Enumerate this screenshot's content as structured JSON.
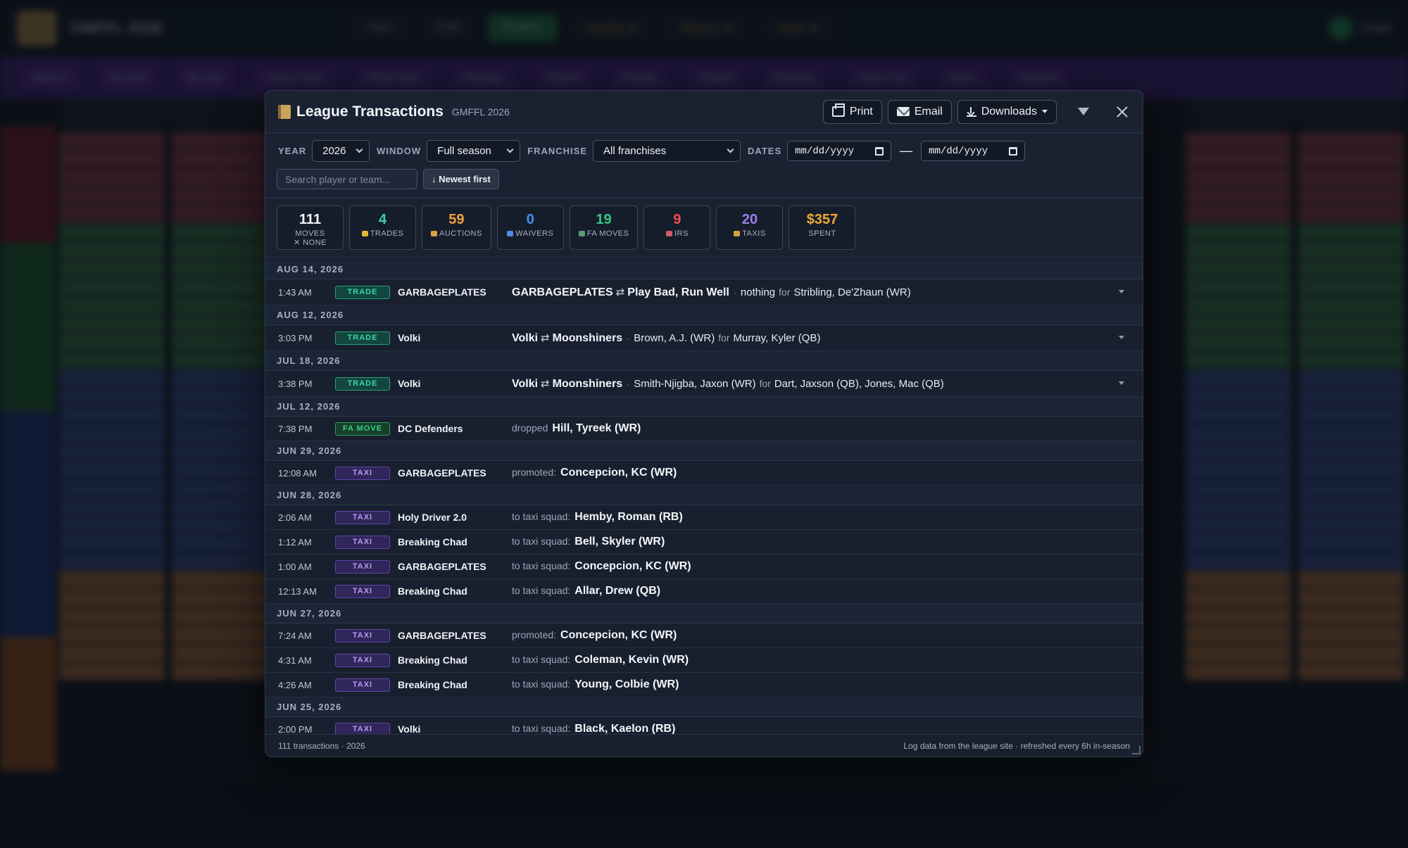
{
  "background_app": {
    "title": "GMFFL 2026",
    "nav": [
      "Start",
      "Draft",
      "Rosters",
      "Trading ★",
      "Waivers ★",
      "News ★"
    ],
    "user": "Chad",
    "subbar": [
      "Week 1",
      "By Slot",
      "By Pos",
      "Jerry's order",
      "What now?",
      "Manage",
      "What-if",
      "Pivotal",
      "Traded",
      "Expiring",
      "Player List",
      "Inbox",
      "Reports"
    ]
  },
  "modal": {
    "title": "League Transactions",
    "subtitle": "GMFFL 2026",
    "print_label": "Print",
    "email_label": "Email",
    "downloads_label": "Downloads"
  },
  "filters": {
    "year_label": "YEAR",
    "year_value": "2026",
    "window_label": "WINDOW",
    "window_value": "Full season",
    "franchise_label": "FRANCHISE",
    "franchise_value": "All franchises",
    "dates_label": "DATES",
    "date_from": "mm/dd/yyyy",
    "date_to": "mm/dd/yyyy",
    "dates_sep": "—",
    "search_placeholder": "Search player or team...",
    "sort_label": "↓ Newest first"
  },
  "stats": [
    {
      "num": "111",
      "label": "MOVES",
      "sub": "✕ NONE",
      "color": "#f2f5f9"
    },
    {
      "num": "4",
      "label": "TRADES",
      "icon": "#e6b63a",
      "color": "#38d2b0"
    },
    {
      "num": "59",
      "label": "AUCTIONS",
      "icon": "#e0a040",
      "color": "#f0a23a"
    },
    {
      "num": "0",
      "label": "WAIVERS",
      "icon": "#4f8ae6",
      "color": "#4a8ff0"
    },
    {
      "num": "19",
      "label": "FA MOVES",
      "icon": "#5a9a74",
      "color": "#34c888"
    },
    {
      "num": "9",
      "label": "IRS",
      "icon": "#d05a6a",
      "color": "#ef4a5a"
    },
    {
      "num": "20",
      "label": "TAXIS",
      "icon": "#d6a33a",
      "color": "#9a82ec"
    },
    {
      "num": "$357",
      "label": "SPENT",
      "color": "#f3a93a"
    }
  ],
  "groups": [
    {
      "date": "AUG 14, 2026",
      "rows": [
        {
          "time": "1:43 AM",
          "badge": "TRADE",
          "kind": "trade",
          "team": "GARBAGEPLATES",
          "t1": "GARBAGEPLATES",
          "t2": "Play Bad, Run Well",
          "gave": "nothing",
          "for": "for",
          "got": "Stribling, De'Zhaun (WR)",
          "expandable": true
        }
      ]
    },
    {
      "date": "AUG 12, 2026",
      "rows": [
        {
          "time": "3:03 PM",
          "badge": "TRADE",
          "kind": "trade",
          "team": "Volki",
          "t1": "Volki",
          "t2": "Moonshiners",
          "gave": "Brown, A.J. (WR)",
          "for": "for",
          "got": "Murray, Kyler (QB)",
          "expandable": true
        }
      ]
    },
    {
      "date": "JUL 18, 2026",
      "rows": [
        {
          "time": "3:38 PM",
          "badge": "TRADE",
          "kind": "trade",
          "team": "Volki",
          "t1": "Volki",
          "t2": "Moonshiners",
          "gave": "Smith-Njigba, Jaxon (WR)",
          "for": "for",
          "got": "Dart, Jaxson (QB), Jones, Mac (QB)",
          "expandable": true
        }
      ]
    },
    {
      "date": "JUL 12, 2026",
      "rows": [
        {
          "time": "7:38 PM",
          "badge": "FA MOVE",
          "kind": "fa",
          "team": "DC Defenders",
          "prefix": "dropped",
          "player": "Hill, Tyreek (WR)"
        }
      ]
    },
    {
      "date": "JUN 29, 2026",
      "rows": [
        {
          "time": "12:08 AM",
          "badge": "TAXI",
          "kind": "taxi",
          "team": "GARBAGEPLATES",
          "prefix": "promoted:",
          "player": "Concepcion, KC (WR)"
        }
      ]
    },
    {
      "date": "JUN 28, 2026",
      "rows": [
        {
          "time": "2:06 AM",
          "badge": "TAXI",
          "kind": "taxi",
          "team": "Holy Driver 2.0",
          "prefix": "to taxi squad:",
          "player": "Hemby, Roman (RB)"
        },
        {
          "time": "1:12 AM",
          "badge": "TAXI",
          "kind": "taxi",
          "team": "Breaking Chad",
          "prefix": "to taxi squad:",
          "player": "Bell, Skyler (WR)"
        },
        {
          "time": "1:00 AM",
          "badge": "TAXI",
          "kind": "taxi",
          "team": "GARBAGEPLATES",
          "prefix": "to taxi squad:",
          "player": "Concepcion, KC (WR)"
        },
        {
          "time": "12:13 AM",
          "badge": "TAXI",
          "kind": "taxi",
          "team": "Breaking Chad",
          "prefix": "to taxi squad:",
          "player": "Allar, Drew (QB)"
        }
      ]
    },
    {
      "date": "JUN 27, 2026",
      "rows": [
        {
          "time": "7:24 AM",
          "badge": "TAXI",
          "kind": "taxi",
          "team": "GARBAGEPLATES",
          "prefix": "promoted:",
          "player": "Concepcion, KC (WR)"
        },
        {
          "time": "4:31 AM",
          "badge": "TAXI",
          "kind": "taxi",
          "team": "Breaking Chad",
          "prefix": "to taxi squad:",
          "player": "Coleman, Kevin (WR)"
        },
        {
          "time": "4:26 AM",
          "badge": "TAXI",
          "kind": "taxi",
          "team": "Breaking Chad",
          "prefix": "to taxi squad:",
          "player": "Young, Colbie (WR)"
        }
      ]
    },
    {
      "date": "JUN 25, 2026",
      "rows": [
        {
          "time": "2:00 PM",
          "badge": "TAXI",
          "kind": "taxi",
          "team": "Volki",
          "prefix": "to taxi squad:",
          "player": "Black, Kaelon (RB)"
        }
      ]
    }
  ],
  "footer": {
    "left": "111 transactions · 2026",
    "right": "Log data from the league site · refreshed every 6h in-season"
  }
}
